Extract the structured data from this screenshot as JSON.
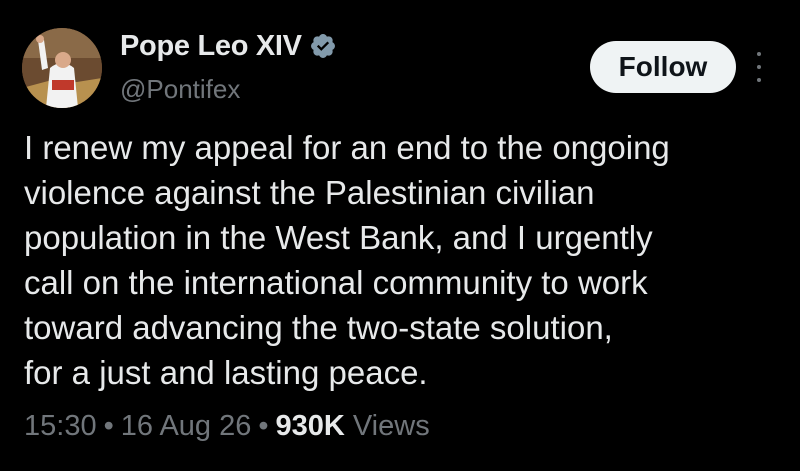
{
  "author": {
    "display_name": "Pope Leo XIV",
    "handle": "@Pontifex",
    "verified_icon": "verified-badge-icon",
    "verified_color": "#829aab"
  },
  "actions": {
    "follow_label": "Follow",
    "more_icon": "more-vertical-icon"
  },
  "tweet": {
    "text_lines": [
      "I renew my appeal for an end to the ongoing",
      "violence against the Palestinian civilian",
      "population in the West Bank, and I urgently",
      "call on the international community to work",
      "toward advancing the two-state solution,",
      "for a just and lasting peace."
    ]
  },
  "meta": {
    "time": "15:30",
    "separator": "•",
    "date": "16 Aug 26",
    "views_count": "930K",
    "views_label": "Views"
  },
  "colors": {
    "background": "#000000",
    "text_primary": "#e7e9ea",
    "text_secondary": "#71767b",
    "follow_bg": "#eff3f4",
    "follow_text": "#0f1419"
  }
}
